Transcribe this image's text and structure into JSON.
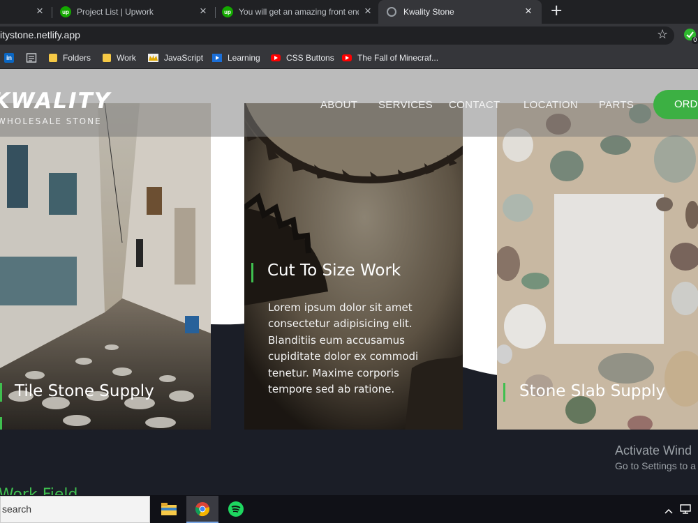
{
  "browser": {
    "tabs": [
      {
        "title": "",
        "favicon": "none"
      },
      {
        "title": "Project List | Upwork",
        "favicon": "upwork-icon"
      },
      {
        "title": "You will get an amazing front end",
        "favicon": "upwork-icon"
      },
      {
        "title": "Kwality Stone",
        "favicon": "globe-icon",
        "active": true
      }
    ],
    "favicon_text": "up",
    "close_glyph": "×",
    "new_tab_glyph": "+",
    "url": "itystone.netlify.app",
    "star_glyph": "☆",
    "extension_badge": "0",
    "bookmarks": [
      {
        "label": "",
        "icon": "linkedin-icon"
      },
      {
        "label": "",
        "icon": "reading-list-icon"
      },
      {
        "label": "Folders",
        "icon": "folder-icon"
      },
      {
        "label": "Work",
        "icon": "folder-icon"
      },
      {
        "label": "JavaScript",
        "icon": "crown-icon"
      },
      {
        "label": "Learning",
        "icon": "play-icon"
      },
      {
        "label": "CSS Buttons",
        "icon": "youtube-icon"
      },
      {
        "label": "The Fall of Minecraf...",
        "icon": "youtube-icon"
      }
    ],
    "linkedin_text": "in"
  },
  "site": {
    "logo_title": "KWALITY",
    "logo_subtitle": "WHOLESALE STONE",
    "nav": [
      "ABOUT",
      "SERVICES",
      "CONTACT",
      "LOCATION",
      "PARTS"
    ],
    "order_button": "ORD",
    "cards": [
      {
        "title": "Tile Stone Supply"
      },
      {
        "title": "Cut To Size Work",
        "body": "Lorem ipsum dolor sit amet consectetur adipisicing elit. Blanditiis eum accusamus cupiditate dolor ex commodi tenetur. Maxime corporis tempore sed ab ratione."
      },
      {
        "title": "Stone Slab Supply"
      }
    ],
    "section_heading": "Work Field",
    "accent_color": "#3fbf4f"
  },
  "windows": {
    "activate_title": "Activate Wind",
    "activate_sub": "Go to Settings to a",
    "search_placeholder": "search",
    "apps": [
      "file-explorer-icon",
      "chrome-icon",
      "spotify-icon"
    ]
  }
}
